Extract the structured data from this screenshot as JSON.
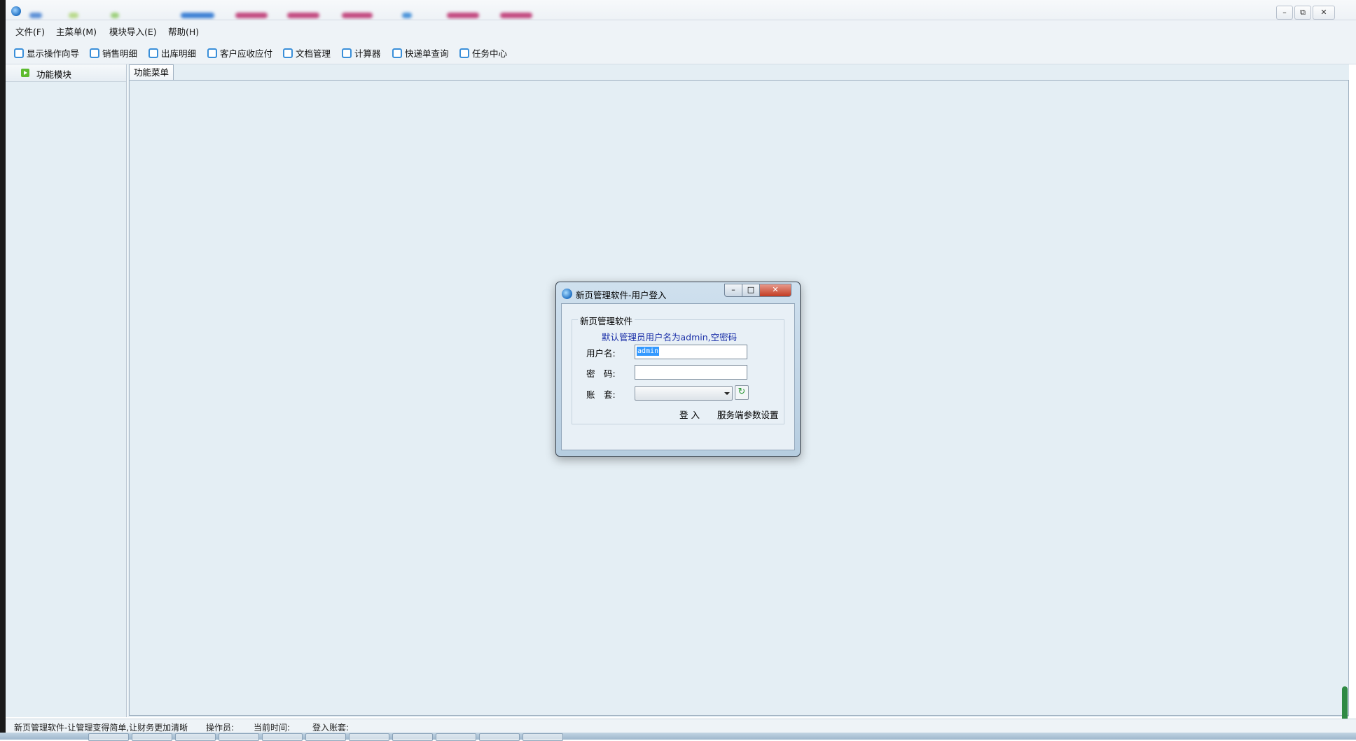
{
  "window": {
    "controls": {
      "minimize": "–",
      "restore": "⧉",
      "close": "✕"
    }
  },
  "menubar": {
    "items": [
      "文件(F)",
      "主菜单(M)",
      "模块导入(E)",
      "帮助(H)"
    ]
  },
  "toolbar": {
    "items": [
      "显示操作向导",
      "销售明细",
      "出库明细",
      "客户应收应付",
      "文档管理",
      "计算器",
      "快递单查询",
      "任务中心"
    ]
  },
  "sidebar": {
    "header": "功能模块"
  },
  "main": {
    "tab": "功能菜单"
  },
  "statusbar": {
    "slogan": "新页管理软件-让管理变得简单,让财务更加清晰",
    "operator_label": "操作员:",
    "time_label": "当前时间:",
    "account_label": "登入账套:"
  },
  "dialog": {
    "title": "新页管理软件-用户登入",
    "controls": {
      "minimize": "–",
      "maximize": "□",
      "close": "✕"
    },
    "group_title": "新页管理软件",
    "hint": "默认管理员用户名为admin,空密码",
    "username_label": "用户名:",
    "username_value": "admin",
    "password_label": "密　码:",
    "password_value": "",
    "account_label": "账　套:",
    "account_value": "",
    "refresh_icon": "↻",
    "login_button": "登 入",
    "server_settings": "服务端参数设置"
  },
  "colors": {
    "accent": "#3a8fd9",
    "panel_bg": "#e4eef4",
    "hint_text": "#1a2fa8",
    "close_button": "#c23b22"
  }
}
